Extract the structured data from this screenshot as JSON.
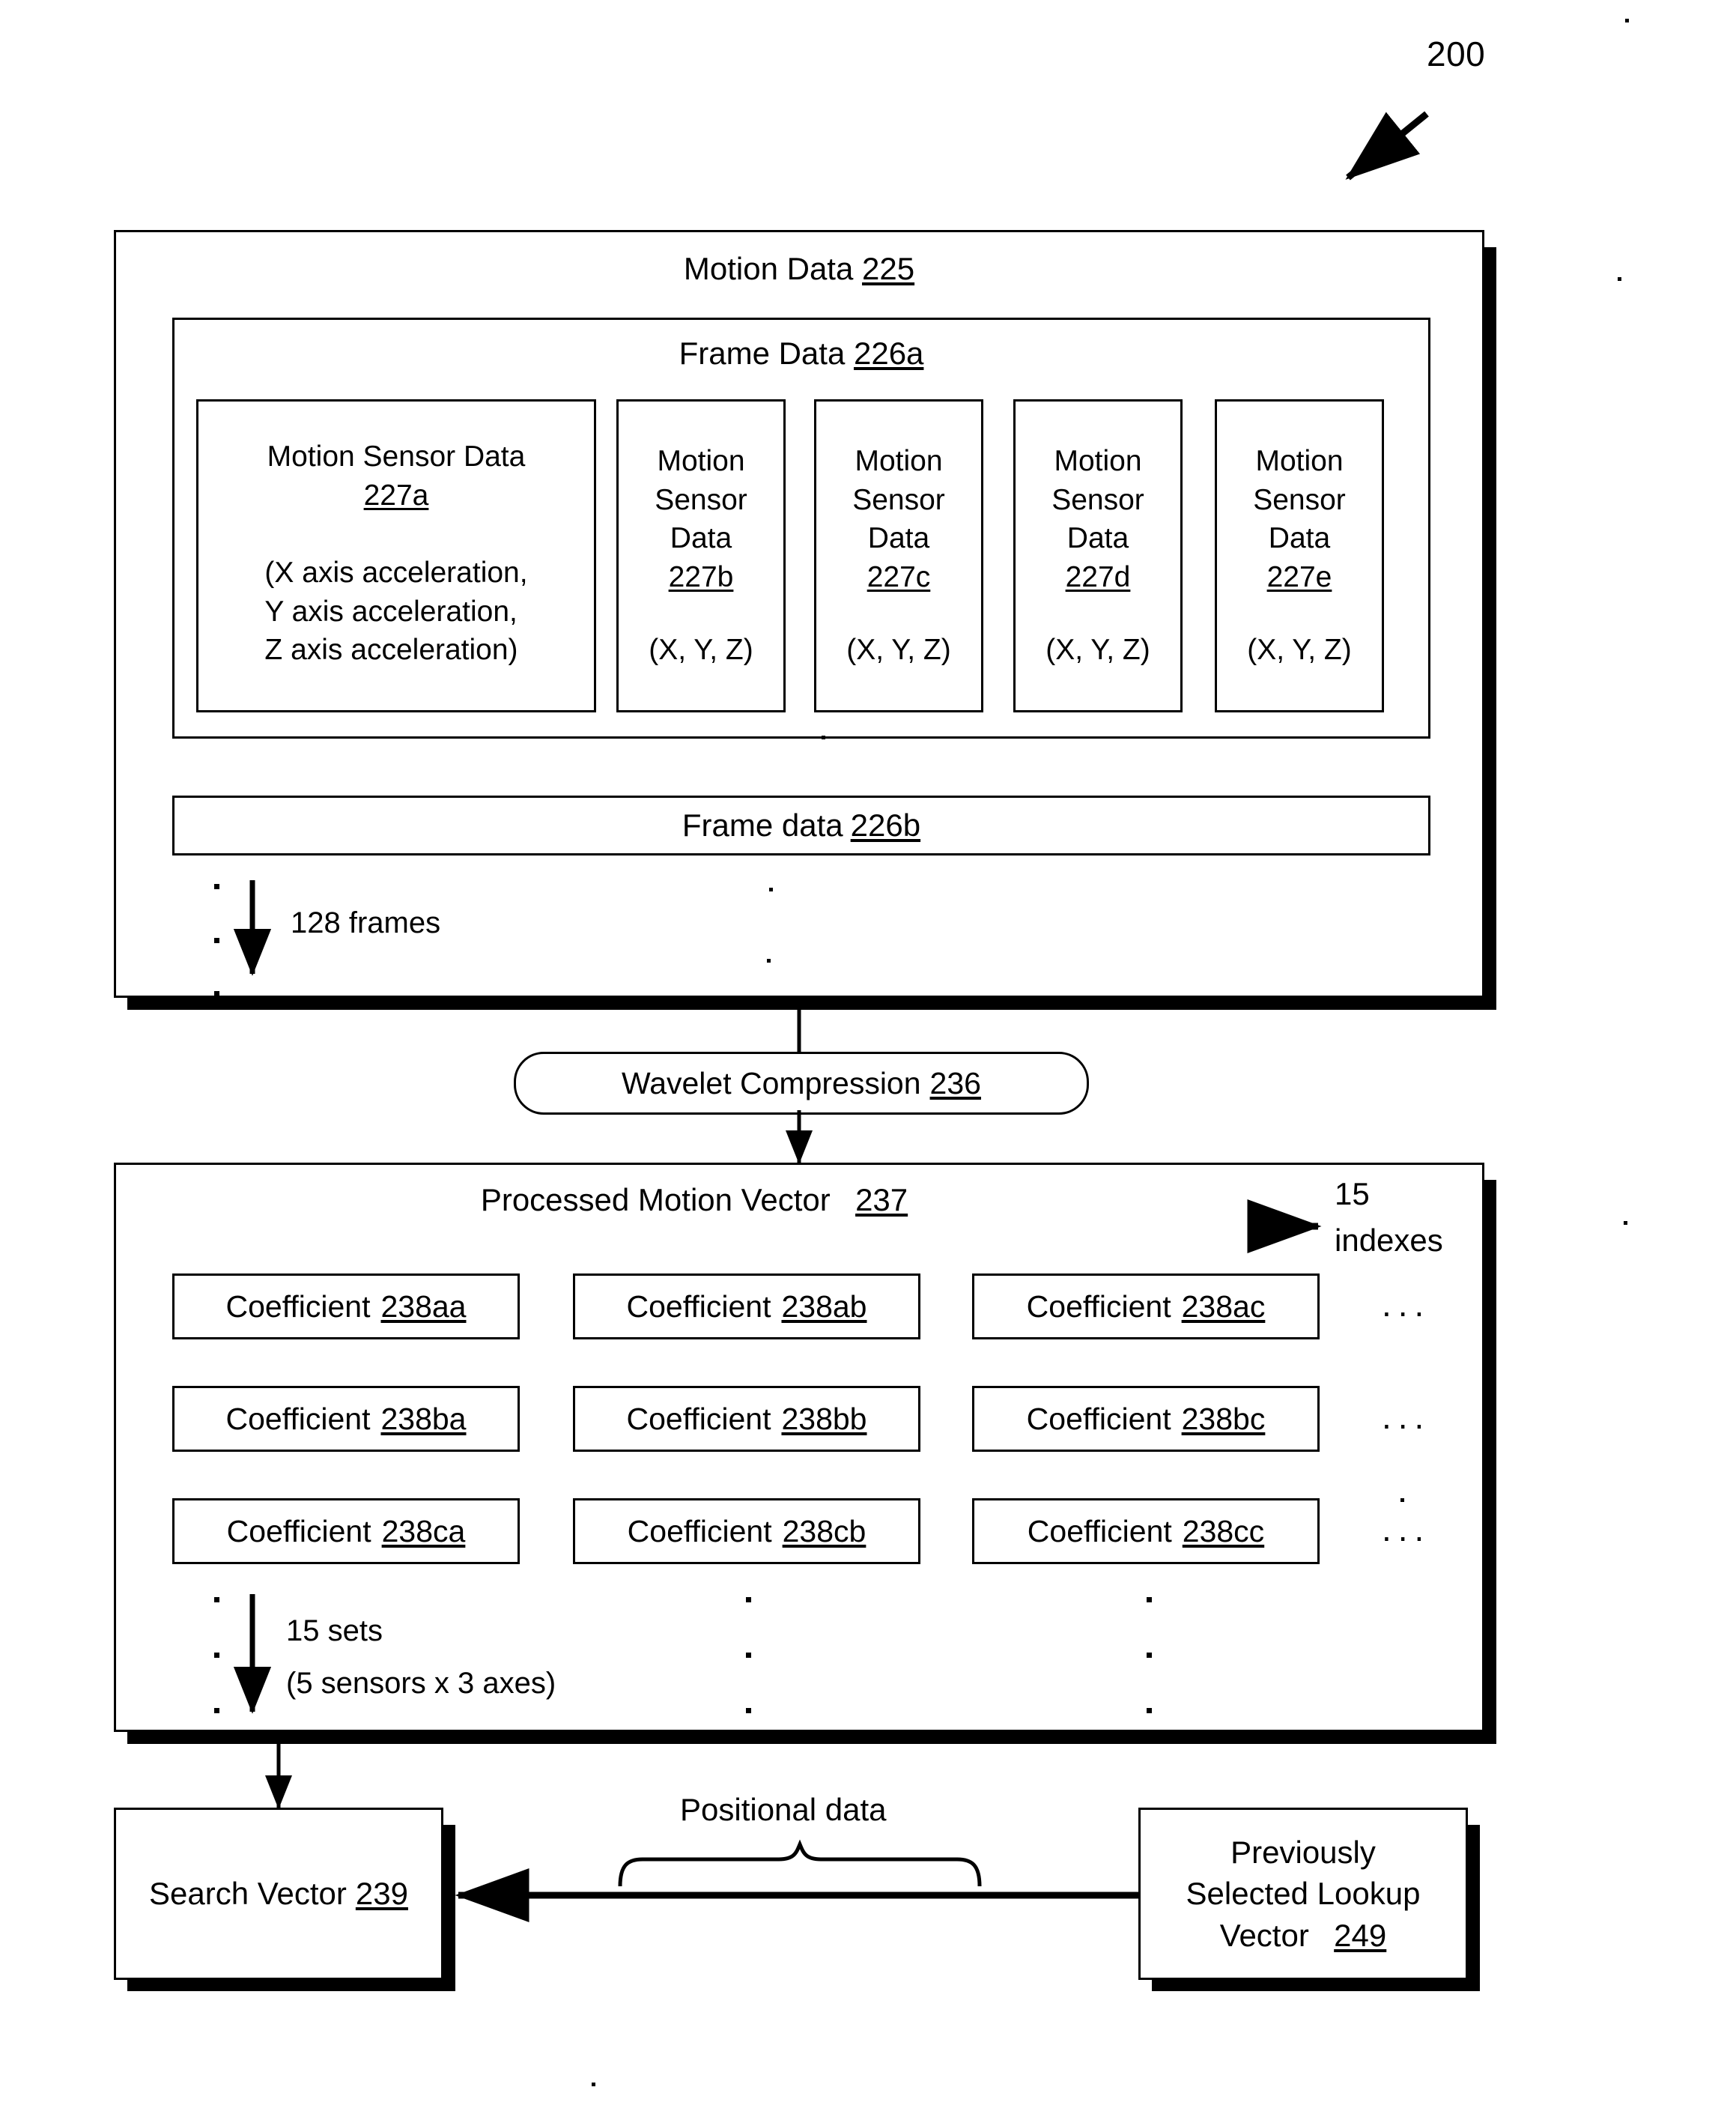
{
  "figure": {
    "number": "200"
  },
  "motion_data": {
    "title": "Motion Data 225",
    "title_text": "Motion Data",
    "title_ref": "225",
    "frame_data_a": {
      "title_text": "Frame Data",
      "title_ref": "226a",
      "sensors": [
        {
          "name_line1": "Motion Sensor Data",
          "ref": "227a",
          "values": "(X axis acceleration,\nY axis acceleration,\nZ axis acceleration)",
          "v1": "(X axis acceleration,",
          "v2": "Y axis acceleration,",
          "v3": "Z axis acceleration)"
        },
        {
          "name_line1": "Motion",
          "name_line2": "Sensor",
          "name_line3": "Data",
          "ref": "227b",
          "values": "(X, Y, Z)"
        },
        {
          "name_line1": "Motion",
          "name_line2": "Sensor",
          "name_line3": "Data",
          "ref": "227c",
          "values": "(X, Y, Z)"
        },
        {
          "name_line1": "Motion",
          "name_line2": "Sensor",
          "name_line3": "Data",
          "ref": "227d",
          "values": "(X, Y, Z)"
        },
        {
          "name_line1": "Motion",
          "name_line2": "Sensor",
          "name_line3": "Data",
          "ref": "227e",
          "values": "(X, Y, Z)"
        }
      ]
    },
    "frame_data_b": {
      "title_text": "Frame data",
      "title_ref": "226b"
    },
    "frames_annotation": "128 frames"
  },
  "process": {
    "wavelet_text": "Wavelet Compression",
    "wavelet_ref": "236"
  },
  "processed_motion_vector": {
    "title_text": "Processed Motion Vector",
    "title_ref": "237",
    "indexes_line1": "15",
    "indexes_line2": "indexes",
    "coefficients": [
      [
        {
          "text": "Coefficient",
          "ref": "238aa"
        },
        {
          "text": "Coefficient",
          "ref": "238ab"
        },
        {
          "text": "Coefficient",
          "ref": "238ac"
        }
      ],
      [
        {
          "text": "Coefficient",
          "ref": "238ba"
        },
        {
          "text": "Coefficient",
          "ref": "238bb"
        },
        {
          "text": "Coefficient",
          "ref": "238bc"
        }
      ],
      [
        {
          "text": "Coefficient",
          "ref": "238ca"
        },
        {
          "text": "Coefficient",
          "ref": "238cb"
        },
        {
          "text": "Coefficient",
          "ref": "238cc"
        }
      ]
    ],
    "ellipsis": "...",
    "sets_line1": "15 sets",
    "sets_line2": "(5 sensors x 3 axes)"
  },
  "bottom": {
    "search_vector_text": "Search Vector",
    "search_vector_ref": "239",
    "positional_data_label": "Positional data",
    "lookup_line1": "Previously",
    "lookup_line2": "Selected Lookup",
    "lookup_line3": "Vector",
    "lookup_ref": "249"
  },
  "colors": {
    "ink": "#000000",
    "paper": "#ffffff"
  }
}
